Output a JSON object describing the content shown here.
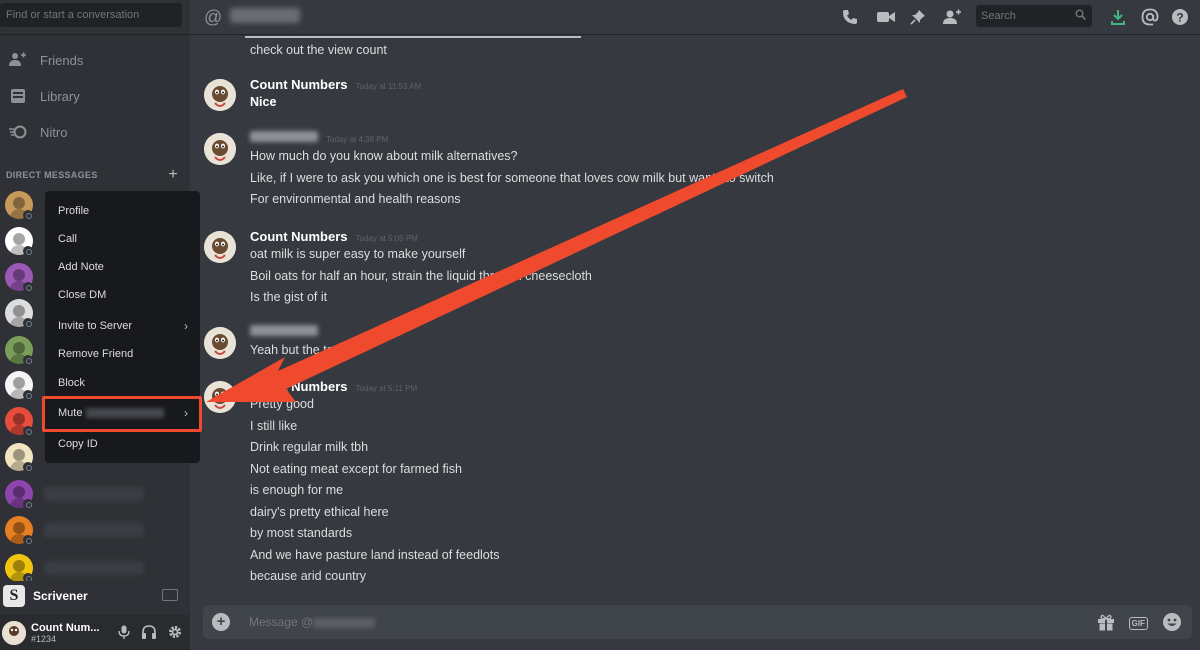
{
  "sidebar": {
    "search_placeholder": "Find or start a conversation",
    "nav": [
      {
        "label": "Friends",
        "icon": "friends-icon"
      },
      {
        "label": "Library",
        "icon": "library-icon"
      },
      {
        "label": "Nitro",
        "icon": "nitro-icon"
      }
    ],
    "dm_header": "DIRECT MESSAGES",
    "dm_add": "+",
    "dm_avatar_colors": [
      "#c89a5a",
      "#ffffff",
      "#9b59b6",
      "#dcddde",
      "#7a9e5a",
      "#f5f5f5",
      "#e74c3c",
      "#f1e4c0",
      "#8e44ad",
      "#e67e22",
      "#f1c40f"
    ],
    "footer_app": "Scrivener",
    "user": {
      "name": "Count Num...",
      "tag": "#1234"
    }
  },
  "context_menu": {
    "items": [
      {
        "label": "Profile",
        "submenu": false
      },
      {
        "label": "Call",
        "submenu": false
      },
      {
        "label": "Add Note",
        "submenu": false
      },
      {
        "label": "Close DM",
        "submenu": false
      },
      {
        "label": "Invite to Server",
        "submenu": true
      },
      {
        "label": "Remove Friend",
        "submenu": false
      },
      {
        "label": "Block",
        "submenu": false
      },
      {
        "label": "Mute",
        "submenu": true
      },
      {
        "label": "Copy ID",
        "submenu": false
      }
    ],
    "highlight_color": "#ef4a2e"
  },
  "topbar": {
    "search_placeholder": "Search",
    "icons": [
      "call-icon",
      "video-icon",
      "pin-icon",
      "add-member-icon",
      "download-icon",
      "mention-icon",
      "help-icon"
    ]
  },
  "messages": {
    "continuation_line": "check out the view count",
    "groups": [
      {
        "author": "Count Numbers",
        "author_hidden": false,
        "time": "Today at 11:53 AM",
        "lines": [
          "Nice"
        ],
        "first_bold": true
      },
      {
        "author": "",
        "author_hidden": true,
        "time": "Today at 4:38 PM",
        "lines": [
          "How much do you know about milk alternatives?",
          "Like, if I were to ask you which one is best for someone that loves cow milk but wants to switch",
          "For environmental and health reasons"
        ],
        "first_bold": false
      },
      {
        "author": "Count Numbers",
        "author_hidden": false,
        "time": "Today at 5:05 PM",
        "lines": [
          "oat milk is super easy to make yourself",
          "Boil oats for half an hour, strain the liquid through cheesecloth",
          "Is the gist of it"
        ],
        "first_bold": false
      },
      {
        "author": "",
        "author_hidden": true,
        "time": "",
        "lines": [
          "Yeah but the taste?"
        ],
        "first_bold": false
      },
      {
        "author": "Count Numbers",
        "author_hidden": false,
        "time": "Today at 5:11 PM",
        "lines": [
          "Pretty good",
          "I still like",
          "Drink regular milk tbh",
          "Not eating meat except for farmed fish",
          "is enough for me",
          "dairy's pretty ethical here",
          "by most standards",
          "And we have pasture land instead of feedlots",
          "because arid country"
        ],
        "first_bold": false
      }
    ]
  },
  "composer": {
    "placeholder_prefix": "Message @",
    "icons": [
      "gift-icon",
      "gif-icon",
      "emoji-icon"
    ],
    "gif_label": "GIF"
  },
  "annotation": {
    "arrow_color": "#ef4a2e"
  }
}
